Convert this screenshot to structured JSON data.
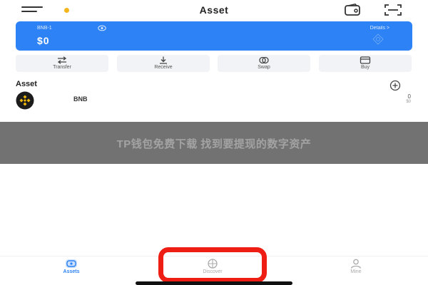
{
  "header": {
    "title": "Asset",
    "menu_icon": "menu-icon",
    "wallet_icon": "wallet-icon",
    "scan_icon": "scan-icon",
    "notification_color": "#f3b41c"
  },
  "wallet": {
    "name": "BNB-1",
    "balance": "$0",
    "details_label": "Details >",
    "card_color": "#2d83f5"
  },
  "actions": [
    {
      "label": "Transfer",
      "icon": "transfer-icon"
    },
    {
      "label": "Receive",
      "icon": "receive-icon"
    },
    {
      "label": "Swap",
      "icon": "swap-icon"
    },
    {
      "label": "Buy",
      "icon": "buy-icon"
    }
  ],
  "assets": {
    "heading": "Asset",
    "add_icon": "add-circle-icon",
    "items": [
      {
        "name": "BNB",
        "amount": "0",
        "value": "$0",
        "icon": "bnb-token-icon",
        "icon_color": "#f0b90b"
      }
    ]
  },
  "watermark": {
    "text": "TP钱包免费下载  找到要提现的数字资产"
  },
  "nav": {
    "items": [
      {
        "label": "Assets",
        "icon": "assets-icon",
        "active": true
      },
      {
        "label": "Discover",
        "icon": "discover-icon",
        "active": false
      },
      {
        "label": "Mine",
        "icon": "mine-icon",
        "active": false
      }
    ],
    "active_color": "#2d83f5",
    "highlight_color": "#ee1e14"
  }
}
